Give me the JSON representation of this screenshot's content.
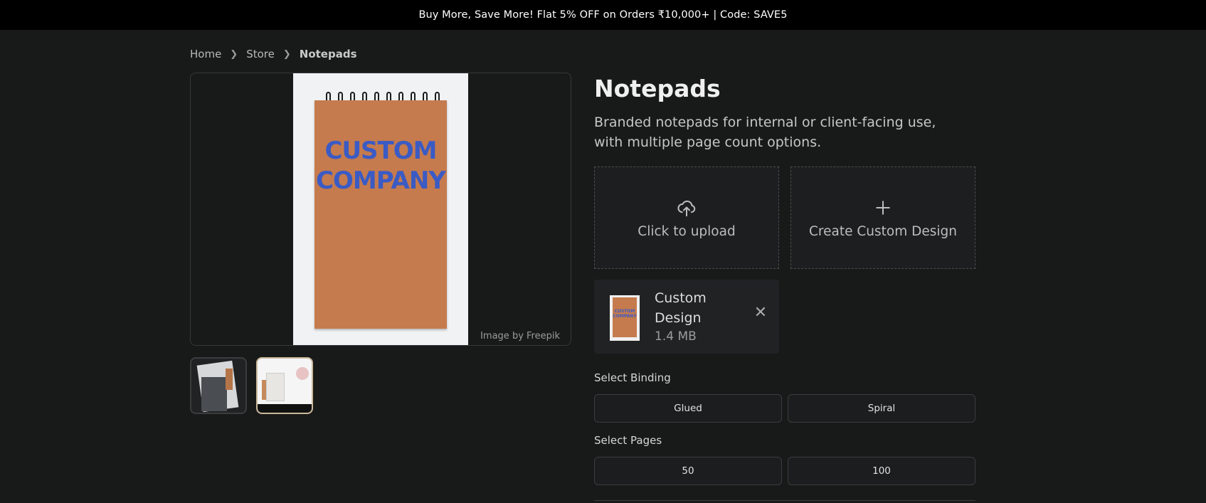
{
  "promo": {
    "text": "Buy More, Save More! Flat 5% OFF on Orders ₹10,000+ | Code: SAVE5"
  },
  "breadcrumb": {
    "items": [
      "Home",
      "Store",
      "Notepads"
    ]
  },
  "gallery": {
    "cover_text_line1": "CUSTOM",
    "cover_text_line2": "COMPANY",
    "credit": "Image by Freepik",
    "selected_thumbnail": 2
  },
  "product": {
    "title": "Notepads",
    "description": "Branded notepads for internal or client-facing use, with multiple page count options."
  },
  "upload": {
    "upload_label": "Click to upload",
    "create_label": "Create Custom Design",
    "upload_icon": "cloud-upload-icon",
    "create_icon": "plus-icon"
  },
  "file": {
    "name": "Custom Design",
    "size": "1.4 MB",
    "thumb_text": "CUSTOM COMPANY"
  },
  "binding": {
    "label": "Select Binding",
    "options": [
      "Glued",
      "Spiral"
    ]
  },
  "pages": {
    "label": "Select Pages",
    "options": [
      "50",
      "100"
    ]
  },
  "colors": {
    "background": "#181a19",
    "promo_bar": "#000000",
    "accent_border": "#c9b89a",
    "cover_brown": "#c57b4e",
    "cover_text_blue": "#3b5bc4"
  }
}
